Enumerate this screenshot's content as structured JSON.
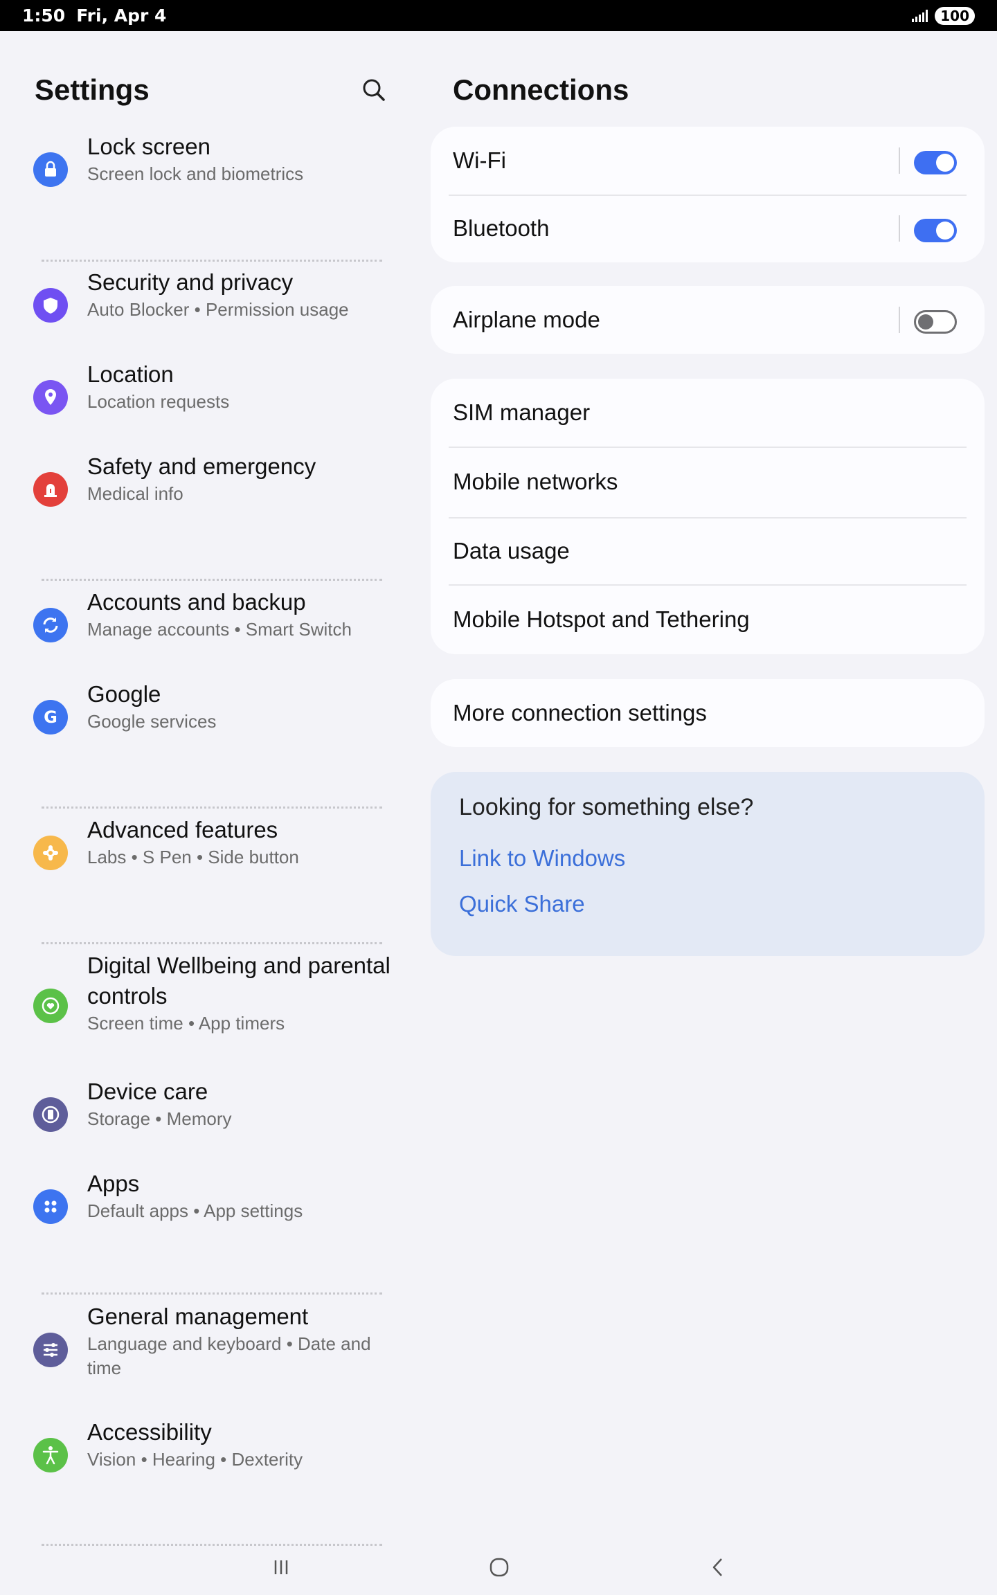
{
  "status_bar": {
    "time": "1:50",
    "date": "Fri, Apr 4",
    "battery": "100"
  },
  "left": {
    "title": "Settings",
    "items": [
      {
        "title": "Lock screen",
        "subtitle": "Screen lock and biometrics",
        "icon": "lock-icon",
        "color": "#3d74f0"
      },
      {
        "title": "Security and privacy",
        "subtitle": "Auto Blocker  •  Permission usage",
        "icon": "shield-icon",
        "color": "#6f4ff2"
      },
      {
        "title": "Location",
        "subtitle": "Location requests",
        "icon": "location-pin-icon",
        "color": "#7a55f2"
      },
      {
        "title": "Safety and emergency",
        "subtitle": "Medical info",
        "icon": "emergency-icon",
        "color": "#e3403b"
      },
      {
        "title": "Accounts and backup",
        "subtitle": "Manage accounts  •  Smart Switch",
        "icon": "sync-icon",
        "color": "#3d74f0"
      },
      {
        "title": "Google",
        "subtitle": "Google services",
        "icon": "google-icon",
        "color": "#3d74f0"
      },
      {
        "title": "Advanced features",
        "subtitle": "Labs  •  S Pen  •  Side button",
        "icon": "puzzle-icon",
        "color": "#f7b84b"
      },
      {
        "title": "Digital Wellbeing and parental controls",
        "subtitle": "Screen time  •  App timers",
        "icon": "wellbeing-icon",
        "color": "#5bc148"
      },
      {
        "title": "Device care",
        "subtitle": "Storage  •  Memory",
        "icon": "device-care-icon",
        "color": "#5e5d9a"
      },
      {
        "title": "Apps",
        "subtitle": "Default apps  •  App settings",
        "icon": "apps-grid-icon",
        "color": "#3d74f0"
      },
      {
        "title": "General management",
        "subtitle": "Language and keyboard  •  Date and time",
        "icon": "sliders-icon",
        "color": "#5e5d9a"
      },
      {
        "title": "Accessibility",
        "subtitle": "Vision  •  Hearing  •  Dexterity",
        "icon": "accessibility-icon",
        "color": "#5bc148"
      }
    ]
  },
  "right": {
    "title": "Connections",
    "wifi": {
      "label": "Wi-Fi",
      "on": true
    },
    "bluetooth": {
      "label": "Bluetooth",
      "on": true
    },
    "airplane": {
      "label": "Airplane mode",
      "on": false
    },
    "network_items": [
      "SIM manager",
      "Mobile networks",
      "Data usage",
      "Mobile Hotspot and Tethering"
    ],
    "more": "More connection settings",
    "suggestions": {
      "title": "Looking for something else?",
      "links": [
        "Link to Windows",
        "Quick Share"
      ]
    }
  },
  "colors": {
    "accent": "#3e6ff2",
    "link": "#3b6fd9"
  }
}
